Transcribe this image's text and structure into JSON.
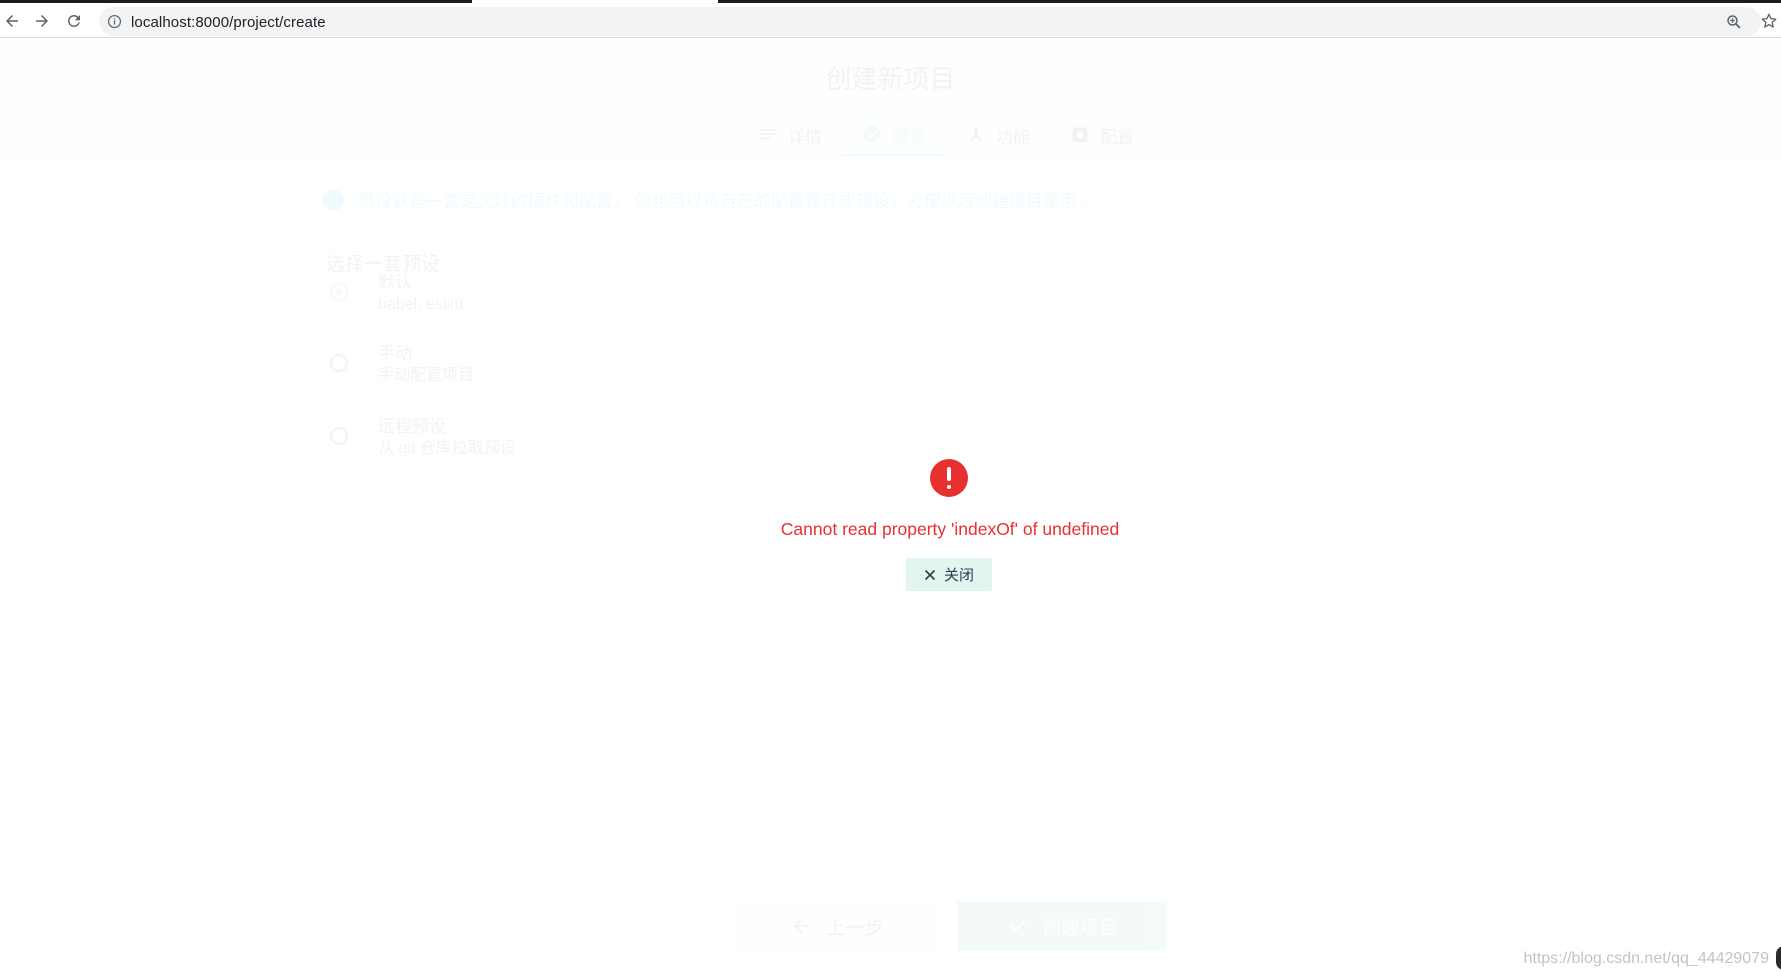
{
  "browser": {
    "url": "localhost:8000/project/create",
    "back_icon": "arrow-left-icon",
    "forward_icon": "arrow-right-icon",
    "reload_icon": "reload-icon",
    "info_icon": "info-circle-icon",
    "zoom_icon": "zoom-icon",
    "bookmark_icon": "star-icon"
  },
  "app": {
    "title": "创建新项目",
    "steps": [
      {
        "label": "详情",
        "icon": "list-icon"
      },
      {
        "label": "预设",
        "icon": "check-circle-icon",
        "active": true
      },
      {
        "label": "功能",
        "icon": "fork-icon"
      },
      {
        "label": "配置",
        "icon": "settings-box-icon"
      }
    ],
    "info_text": "预设就是一套定义好的插件和配置。 你也可以将自己的配置保存成预设，方便以后创建项目使用。",
    "section_label": "选择一套预设",
    "presets": [
      {
        "name": "默认",
        "desc": "babel, eslint",
        "selected": true
      },
      {
        "name": "手动",
        "desc": "手动配置项目",
        "selected": false
      },
      {
        "name": "远程预设",
        "desc": "从 git 仓库拉取预设",
        "selected": false
      }
    ],
    "prev_button": "上一步",
    "create_button": "创建项目"
  },
  "error": {
    "icon": "error-circle-icon",
    "message": "Cannot read property 'indexOf' of undefined",
    "close_label": "关闭",
    "close_icon": "close-icon"
  },
  "watermark": "https://blog.csdn.net/qq_44429079",
  "colors": {
    "error_red": "#e83030",
    "accent_green": "#42b983",
    "close_button_bg": "#e2f5ee"
  }
}
